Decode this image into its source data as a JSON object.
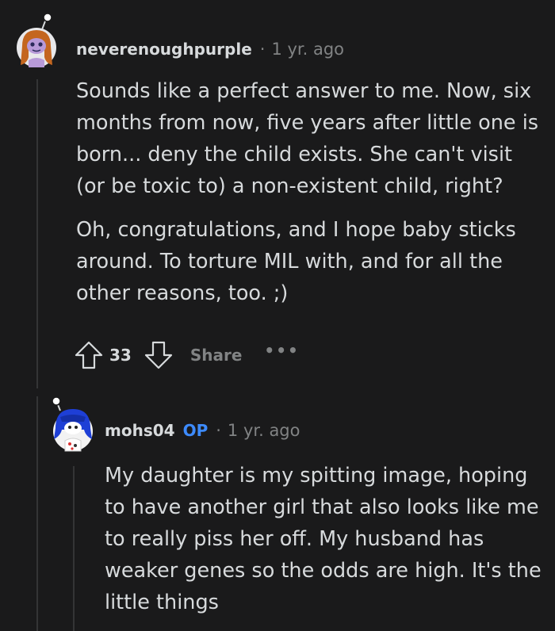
{
  "comments": [
    {
      "username": "neverenoughpurple",
      "separator": "·",
      "time": "1 yr. ago",
      "paragraphs": [
        "Sounds like a perfect answer to me. Now, six months from now, five years after little one is born... deny the child exists. She can't visit (or be toxic to) a non-existent child, right?",
        "Oh, congratulations, and I hope baby sticks around. To torture MIL with, and for all the other reasons, too. ;)"
      ],
      "score": "33",
      "share_label": "Share",
      "more_label": "•••",
      "avatar_icon": "snoo-avatar-purple-hair-icon"
    },
    {
      "username": "mohs04",
      "op_badge": "OP",
      "separator": "·",
      "time": "1 yr. ago",
      "paragraphs": [
        "My daughter is my spitting image, hoping to have another girl that also looks like me to really piss her off. My husband has weaker genes so the odds are high. It's the little things"
      ],
      "avatar_icon": "snoo-avatar-blue-hair-icon"
    }
  ],
  "colors": {
    "background": "#1a1a1b",
    "text": "#d7dadc",
    "muted": "#818384",
    "op_badge": "#3d8bfd",
    "thread_line": "#343536"
  }
}
